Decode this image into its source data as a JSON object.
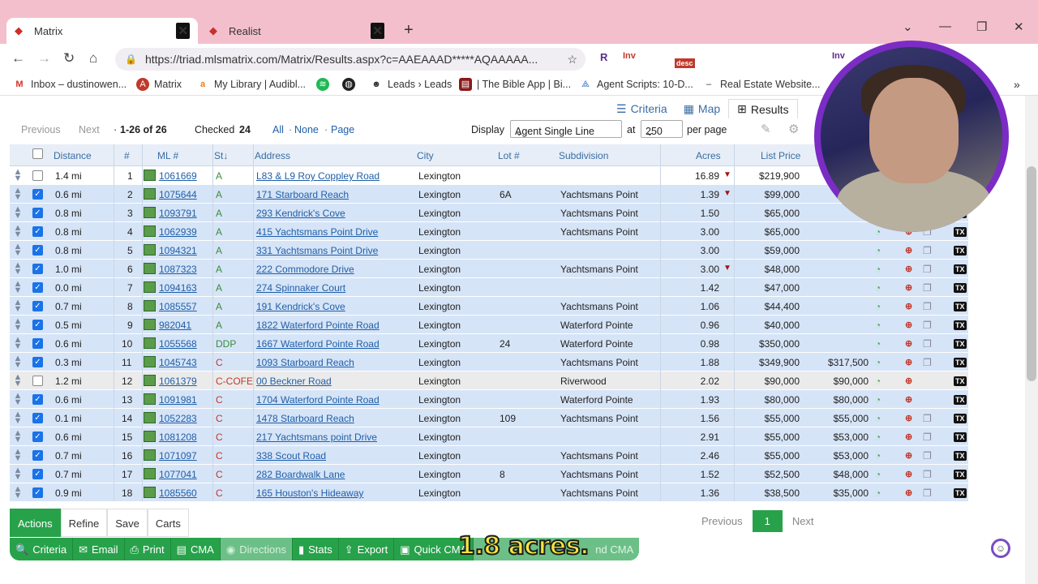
{
  "browser": {
    "tabs": [
      {
        "label": "Matrix",
        "active": true
      },
      {
        "label": "Realist",
        "active": false
      }
    ],
    "url": "https://triad.mlsmatrix.com/Matrix/Results.aspx?c=AAEAAAD*****AQAAAAA...",
    "extensions": [
      "R",
      "Inv",
      "desc",
      "Inv"
    ],
    "bookmarks": [
      "Inbox – dustinowen...",
      "Matrix",
      "My Library | Audibl...",
      "Leads › Leads",
      "| The Bible App | Bi...",
      "Agent Scripts: 10-D...",
      "Real Estate Website..."
    ]
  },
  "view_tabs": [
    "Criteria",
    "Map",
    "Results"
  ],
  "controls": {
    "previous": "Previous",
    "next": "Next",
    "range": "1-26 of 26",
    "checked_label": "Checked",
    "checked_count": "24",
    "all": "All",
    "none": "None",
    "page": "Page",
    "display_label": "Display",
    "display_value": "Agent Single Line",
    "at_label": "at",
    "per_page_value": "250",
    "per_page_label": "per page"
  },
  "columns": [
    "Distance",
    "#",
    "ML #",
    "St",
    "Address",
    "City",
    "Lot #",
    "Subdivision",
    "Acres",
    "List Price"
  ],
  "rows": [
    {
      "checked": false,
      "dist": "1.4 mi",
      "n": "1",
      "ml": "1061669",
      "st": "A",
      "addr": "L83 & L9 Roy Coppley Road",
      "city": "Lexington",
      "lot": "",
      "sub": "",
      "acres": "16.89",
      "arrow": true,
      "price": "$219,900",
      "sold": ""
    },
    {
      "checked": true,
      "dist": "0.6 mi",
      "n": "2",
      "ml": "1075644",
      "st": "A",
      "addr": "171 Starboard Reach",
      "city": "Lexington",
      "lot": "6A",
      "sub": "Yachtsmans Point",
      "acres": "1.39",
      "arrow": true,
      "price": "$99,000",
      "sold": ""
    },
    {
      "checked": true,
      "dist": "0.8 mi",
      "n": "3",
      "ml": "1093791",
      "st": "A",
      "addr": "293 Kendrick's Cove",
      "city": "Lexington",
      "lot": "",
      "sub": "Yachtsmans Point",
      "acres": "1.50",
      "arrow": false,
      "price": "$65,000",
      "sold": ""
    },
    {
      "checked": true,
      "dist": "0.8 mi",
      "n": "4",
      "ml": "1062939",
      "st": "A",
      "addr": "415 Yachtsmans Point Drive",
      "city": "Lexington",
      "lot": "",
      "sub": "Yachtsmans Point",
      "acres": "3.00",
      "arrow": false,
      "price": "$65,000",
      "sold": ""
    },
    {
      "checked": true,
      "dist": "0.8 mi",
      "n": "5",
      "ml": "1094321",
      "st": "A",
      "addr": "331 Yachtsmans Point Drive",
      "city": "Lexington",
      "lot": "",
      "sub": "",
      "acres": "3.00",
      "arrow": false,
      "price": "$59,000",
      "sold": ""
    },
    {
      "checked": true,
      "dist": "1.0 mi",
      "n": "6",
      "ml": "1087323",
      "st": "A",
      "addr": "222 Commodore Drive",
      "city": "Lexington",
      "lot": "",
      "sub": "Yachtsmans Point",
      "acres": "3.00",
      "arrow": true,
      "price": "$48,000",
      "sold": ""
    },
    {
      "checked": true,
      "dist": "0.0 mi",
      "n": "7",
      "ml": "1094163",
      "st": "A",
      "addr": "274 Spinnaker Court",
      "city": "Lexington",
      "lot": "",
      "sub": "",
      "acres": "1.42",
      "arrow": false,
      "price": "$47,000",
      "sold": ""
    },
    {
      "checked": true,
      "dist": "0.7 mi",
      "n": "8",
      "ml": "1085557",
      "st": "A",
      "addr": "191 Kendrick's Cove",
      "city": "Lexington",
      "lot": "",
      "sub": "Yachtsmans Point",
      "acres": "1.06",
      "arrow": false,
      "price": "$44,400",
      "sold": ""
    },
    {
      "checked": true,
      "dist": "0.5 mi",
      "n": "9",
      "ml": "982041",
      "st": "A",
      "addr": "1822 Waterford Pointe Road",
      "city": "Lexington",
      "lot": "",
      "sub": "Waterford Pointe",
      "acres": "0.96",
      "arrow": false,
      "price": "$40,000",
      "sold": ""
    },
    {
      "checked": true,
      "dist": "0.6 mi",
      "n": "10",
      "ml": "1055568",
      "st": "DDP",
      "addr": "1667 Waterford Pointe Road",
      "city": "Lexington",
      "lot": "24",
      "sub": "Waterford Pointe",
      "acres": "0.98",
      "arrow": false,
      "price": "$350,000",
      "sold": ""
    },
    {
      "checked": true,
      "dist": "0.3 mi",
      "n": "11",
      "ml": "1045743",
      "st": "C",
      "addr": "1093 Starboard Reach",
      "city": "Lexington",
      "lot": "",
      "sub": "Yachtsmans Point",
      "acres": "1.88",
      "arrow": false,
      "price": "$349,900",
      "sold": "$317,500"
    },
    {
      "checked": false,
      "dist": "1.2 mi",
      "n": "12",
      "ml": "1061379",
      "st": "C-COFE",
      "addr": "00 Beckner Road",
      "city": "Lexington",
      "lot": "",
      "sub": "Riverwood",
      "acres": "2.02",
      "arrow": false,
      "price": "$90,000",
      "sold": "$90,000"
    },
    {
      "checked": true,
      "dist": "0.6 mi",
      "n": "13",
      "ml": "1091981",
      "st": "C",
      "addr": "1704 Waterford Pointe Road",
      "city": "Lexington",
      "lot": "",
      "sub": "Waterford Pointe",
      "acres": "1.93",
      "arrow": false,
      "price": "$80,000",
      "sold": "$80,000"
    },
    {
      "checked": true,
      "dist": "0.1 mi",
      "n": "14",
      "ml": "1052283",
      "st": "C",
      "addr": "1478 Starboard Reach",
      "city": "Lexington",
      "lot": "109",
      "sub": "Yachtsmans Point",
      "acres": "1.56",
      "arrow": false,
      "price": "$55,000",
      "sold": "$55,000"
    },
    {
      "checked": true,
      "dist": "0.6 mi",
      "n": "15",
      "ml": "1081208",
      "st": "C",
      "addr": "217 Yachtsmans point Drive",
      "city": "Lexington",
      "lot": "",
      "sub": "",
      "acres": "2.91",
      "arrow": false,
      "price": "$55,000",
      "sold": "$53,000"
    },
    {
      "checked": true,
      "dist": "0.7 mi",
      "n": "16",
      "ml": "1071097",
      "st": "C",
      "addr": "338 Scout Road",
      "city": "Lexington",
      "lot": "",
      "sub": "Yachtsmans Point",
      "acres": "2.46",
      "arrow": false,
      "price": "$55,000",
      "sold": "$53,000"
    },
    {
      "checked": true,
      "dist": "0.7 mi",
      "n": "17",
      "ml": "1077041",
      "st": "C",
      "addr": "282 Boardwalk Lane",
      "city": "Lexington",
      "lot": "8",
      "sub": "Yachtsmans Point",
      "acres": "1.52",
      "arrow": false,
      "price": "$52,500",
      "sold": "$48,000"
    },
    {
      "checked": true,
      "dist": "0.9 mi",
      "n": "18",
      "ml": "1085560",
      "st": "C",
      "addr": "165 Houston's Hideaway",
      "city": "Lexington",
      "lot": "",
      "sub": "Yachtsmans Point",
      "acres": "1.36",
      "arrow": false,
      "price": "$38,500",
      "sold": "$35,000"
    }
  ],
  "bottom_tabs": [
    "Actions",
    "Refine",
    "Save",
    "Carts"
  ],
  "toolbar": [
    "Criteria",
    "Email",
    "Print",
    "CMA",
    "Directions",
    "Stats",
    "Export",
    "Quick CMA"
  ],
  "toolbar_continued": "nd CMA",
  "pager": {
    "previous": "Previous",
    "page": "1",
    "next": "Next"
  },
  "caption": "1.8 acres.",
  "colors": {
    "grid_checked": "#d6e4f7",
    "link": "#1f5fa8",
    "action_green": "#27a24a",
    "tab_bar": "#f4bfcc"
  }
}
